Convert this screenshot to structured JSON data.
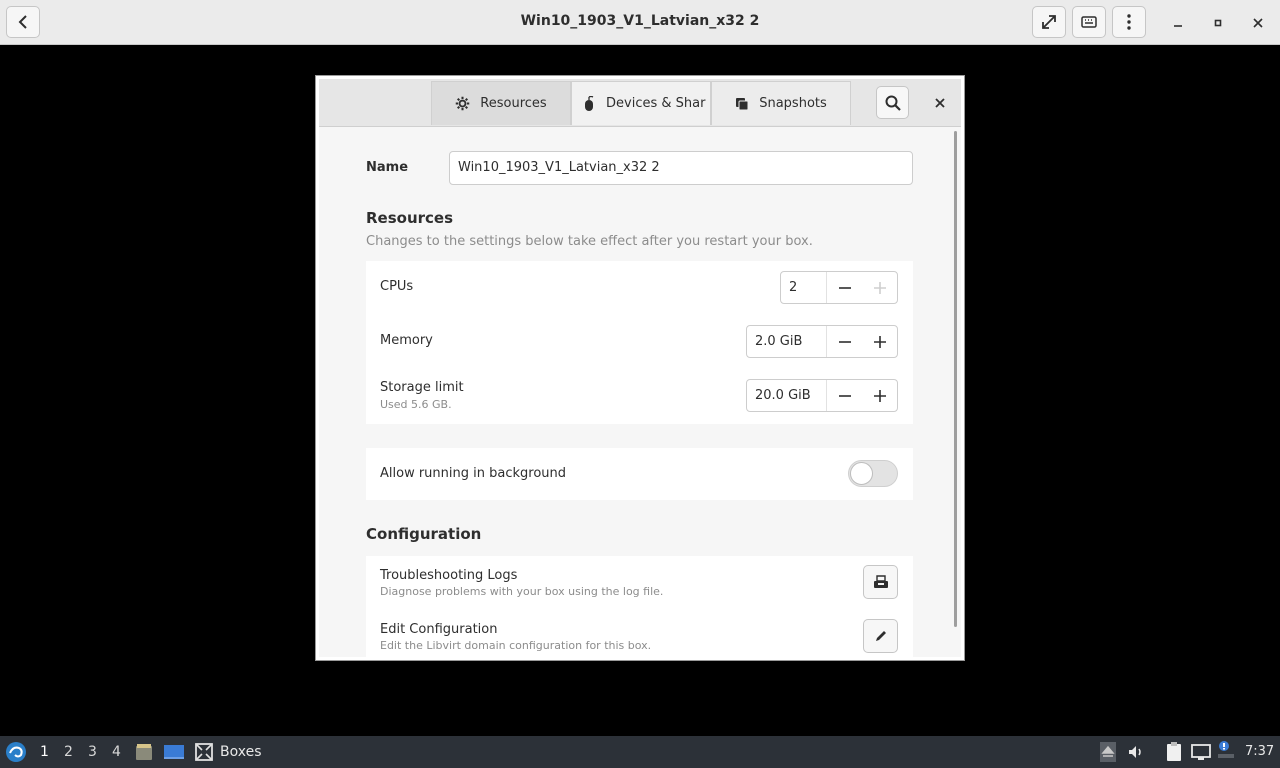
{
  "titlebar": {
    "title": "Win10_1903_V1_Latvian_x32 2",
    "back_icon": "chevron-left-icon",
    "fullscreen_icon": "fullscreen-icon",
    "keyboard_icon": "keyboard-icon",
    "menu_icon": "vertical-dots-icon"
  },
  "dialog": {
    "tabs": [
      {
        "label": "Resources",
        "icon": "gear-icon"
      },
      {
        "label": "Devices & Shar",
        "icon": "mouse-icon"
      },
      {
        "label": "Snapshots",
        "icon": "snapshots-icon"
      }
    ],
    "name_label": "Name",
    "name_value": "Win10_1903_V1_Latvian_x32 2",
    "resources": {
      "title": "Resources",
      "subtitle": "Changes to the settings below take effect after you restart your box.",
      "cpus": {
        "label": "CPUs",
        "value": "2"
      },
      "memory": {
        "label": "Memory",
        "value": "2.0 GiB"
      },
      "storage": {
        "label": "Storage limit",
        "sub": "Used 5.6 GB.",
        "value": "20.0 GiB"
      }
    },
    "background": {
      "label": "Allow running in background",
      "enabled": false
    },
    "configuration": {
      "title": "Configuration",
      "logs": {
        "label": "Troubleshooting Logs",
        "sub": "Diagnose problems with your box using the log file."
      },
      "edit": {
        "label": "Edit Configuration",
        "sub": "Edit the Libvirt domain configuration for this box."
      }
    }
  },
  "taskbar": {
    "workspaces": [
      "1",
      "2",
      "3",
      "4"
    ],
    "app_label": "Boxes",
    "clock": "7:37"
  }
}
